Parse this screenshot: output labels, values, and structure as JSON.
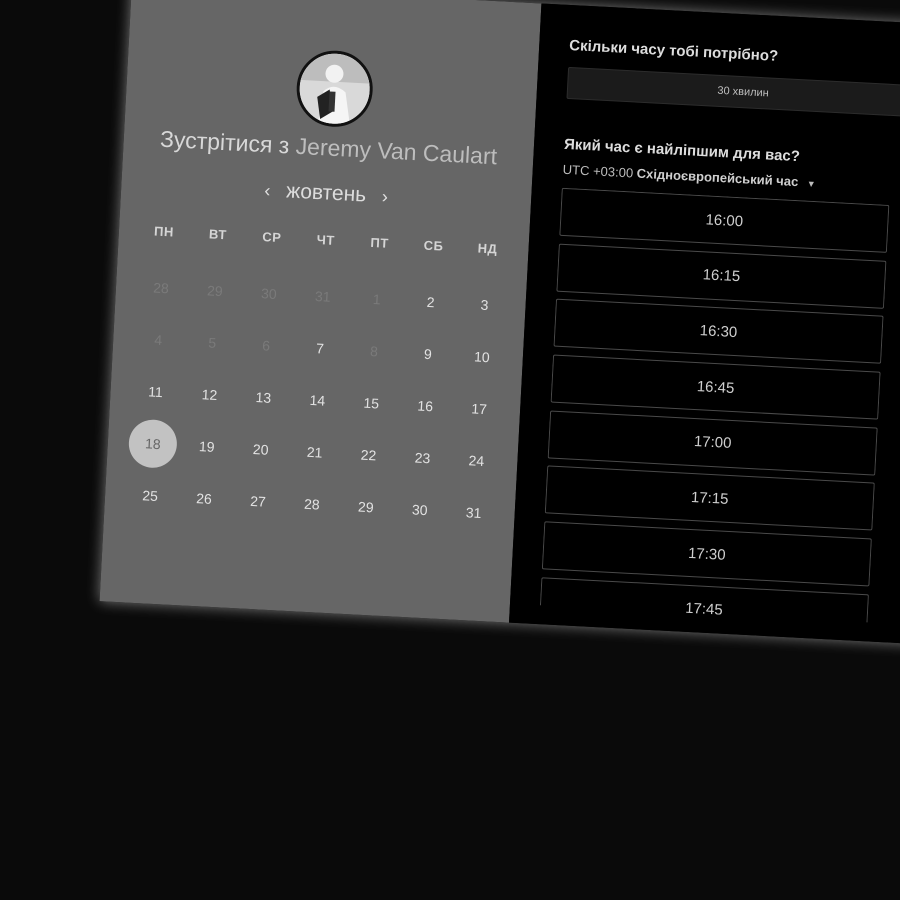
{
  "scheduler": {
    "title_prefix": "Зустрітися з",
    "host_name": "Jeremy Van Caulart",
    "month": "жовтень",
    "prev_arrow": "‹",
    "next_arrow": "›",
    "weekdays": [
      "ПН",
      "ВТ",
      "СР",
      "ЧТ",
      "ПТ",
      "СБ",
      "НД"
    ],
    "days": [
      {
        "label": "28",
        "state": "muted"
      },
      {
        "label": "29",
        "state": "muted"
      },
      {
        "label": "30",
        "state": "muted"
      },
      {
        "label": "31",
        "state": "muted"
      },
      {
        "label": "1",
        "state": "muted"
      },
      {
        "label": "2",
        "state": "normal"
      },
      {
        "label": "3",
        "state": "normal"
      },
      {
        "label": "4",
        "state": "muted"
      },
      {
        "label": "5",
        "state": "muted"
      },
      {
        "label": "6",
        "state": "muted"
      },
      {
        "label": "7",
        "state": "normal"
      },
      {
        "label": "8",
        "state": "muted"
      },
      {
        "label": "9",
        "state": "normal"
      },
      {
        "label": "10",
        "state": "normal"
      },
      {
        "label": "11",
        "state": "normal"
      },
      {
        "label": "12",
        "state": "normal"
      },
      {
        "label": "13",
        "state": "normal"
      },
      {
        "label": "14",
        "state": "normal"
      },
      {
        "label": "15",
        "state": "normal"
      },
      {
        "label": "16",
        "state": "normal"
      },
      {
        "label": "17",
        "state": "normal"
      },
      {
        "label": "18",
        "state": "selected"
      },
      {
        "label": "19",
        "state": "normal"
      },
      {
        "label": "20",
        "state": "normal"
      },
      {
        "label": "21",
        "state": "normal"
      },
      {
        "label": "22",
        "state": "normal"
      },
      {
        "label": "23",
        "state": "normal"
      },
      {
        "label": "24",
        "state": "normal"
      },
      {
        "label": "25",
        "state": "normal"
      },
      {
        "label": "26",
        "state": "normal"
      },
      {
        "label": "27",
        "state": "normal"
      },
      {
        "label": "28",
        "state": "normal"
      },
      {
        "label": "29",
        "state": "normal"
      },
      {
        "label": "30",
        "state": "normal"
      },
      {
        "label": "31",
        "state": "normal"
      }
    ]
  },
  "booking": {
    "duration_question": "Скільки часу тобі потрібно?",
    "duration_value": "30 хвилин",
    "time_question": "Який час є найліпшим для вас?",
    "tz_offset": "UTC +03:00",
    "tz_name": "Східноєвропейський час",
    "tz_caret": "▼",
    "slots": [
      "16:00",
      "16:15",
      "16:30",
      "16:45",
      "17:00",
      "17:15",
      "17:30",
      "17:45"
    ]
  },
  "colors": {
    "left_panel": "#666666",
    "right_panel": "#000000",
    "selected_day": "#c2c2c2"
  },
  "icons": {
    "avatar": "host-avatar-photo",
    "prev": "chevron-left-icon",
    "next": "chevron-right-icon",
    "tz_dropdown": "caret-down-icon"
  }
}
